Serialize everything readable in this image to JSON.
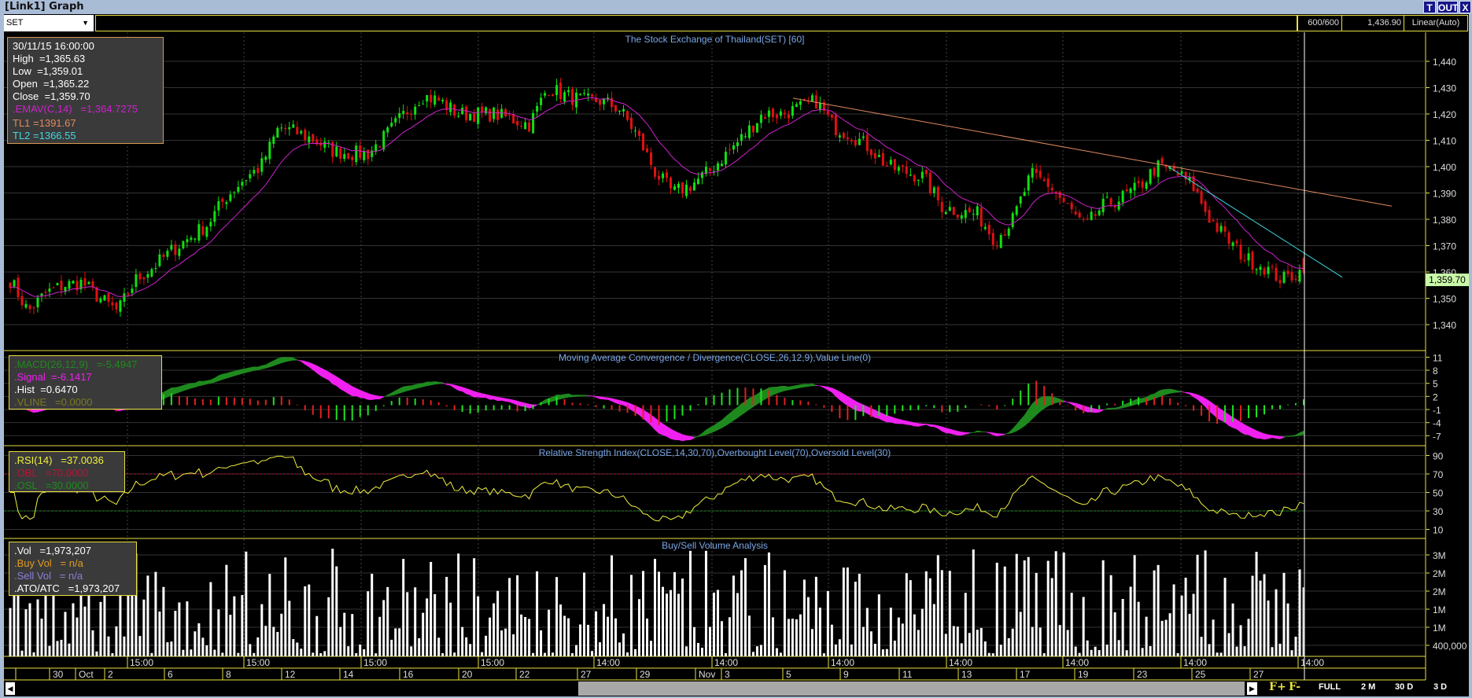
{
  "window": {
    "title": "[Link1] Graph",
    "buttons": [
      "T",
      "OUT",
      "X"
    ]
  },
  "toolbar": {
    "symbol": "SET",
    "bars": "600/600",
    "cursor_price": "1,436.90",
    "scale_mode": "Linear(Auto)"
  },
  "colors": {
    "up": "#10e010",
    "down": "#e01010",
    "ema": "#d020d0",
    "tl1": "#e08a60",
    "tl2": "#40d8e0",
    "axis": "#e8e040",
    "macd": "#1e8a1e",
    "signal": "#f020f0",
    "rsi": "#f0f040",
    "obl": "#b01838",
    "osl": "#1e8a1e",
    "buy": "#e09a20",
    "sell": "#8a80d8",
    "last_price_bg": "#c8f8a8"
  },
  "price_panel": {
    "title": "The Stock Exchange of Thailand(SET) [60]",
    "info": {
      "datetime": "30/11/15 16:00:00",
      "high": "High  =1,365.63",
      "low": "Low  =1,359.01",
      "open": "Open  =1,365.22",
      "close": "Close  =1,359.70",
      "ema": ".EMAV(C,14)   =1,364.7275",
      "tl1": "TL1 =1391.67",
      "tl2": "TL2 =1366.55"
    },
    "y_ticks": [
      "1,440",
      "1,430",
      "1,420",
      "1,410",
      "1,400",
      "1,390",
      "1,380",
      "1,370",
      "1,360",
      "1,350",
      "1,340"
    ],
    "last_price": "1,359.70"
  },
  "macd_panel": {
    "title": "Moving Average Convergence / Divergence(CLOSE,26,12,9),Value Line(0)",
    "info": {
      "macd": ".MACD(26,12,9)   =-5.4947",
      "signal": ".Signal  =-6.1417",
      "hist": ".Hist  =0.6470",
      "vline": ".VLINE   =0.0000"
    },
    "y_ticks": [
      "11",
      "8",
      "5",
      "2",
      "-1",
      "-4",
      "-7"
    ]
  },
  "rsi_panel": {
    "title": "Relative Strength Index(CLOSE,14,30,70),Overbought Level(70),Oversold Level(30)",
    "info": {
      "rsi": ".RSI(14)   =37.0036",
      "obl": ".OBL   =70.0000",
      "osl": ".OSL   =30.0000"
    },
    "y_ticks": [
      "90",
      "70",
      "50",
      "30",
      "10"
    ]
  },
  "volume_panel": {
    "title": "Buy/Sell Volume Analysis",
    "info": {
      "vol": ".Vol   =1,973,207",
      "buy": ".Buy Vol   = n/a",
      "sell": ".Sell Vol   = n/a",
      "ato": ".ATO/ATC   =1,973,207"
    },
    "y_ticks": [
      "3M",
      "2M",
      "2M",
      "1M",
      "1M",
      "400,000"
    ]
  },
  "time_axis": {
    "times": [
      "15:00",
      "15:00",
      "15:00",
      "15:00",
      "14:00",
      "14:00",
      "14:00",
      "14:00",
      "14:00",
      "14:00",
      "14:00"
    ],
    "dates": [
      "30",
      "Oct",
      "2",
      "6",
      "8",
      "12",
      "14",
      "16",
      "20",
      "22",
      "27",
      "29",
      "Nov",
      "3",
      "5",
      "9",
      "11",
      "13",
      "17",
      "19",
      "23",
      "25",
      "27"
    ]
  },
  "controls": {
    "zoom_in": "F+",
    "zoom_out": "F-",
    "ranges": [
      "FULL",
      "2 M",
      "30 D",
      "3 D"
    ]
  },
  "chart_data": {
    "type": "candlestick",
    "interval": "60 min",
    "close_path": [
      1357,
      1345,
      1352,
      1355,
      1356,
      1350,
      1345,
      1357,
      1362,
      1368,
      1373,
      1378,
      1388,
      1395,
      1400,
      1415,
      1413,
      1410,
      1406,
      1405,
      1405,
      1412,
      1420,
      1427,
      1425,
      1420,
      1420,
      1420,
      1418,
      1416,
      1430,
      1427,
      1425,
      1425,
      1422,
      1412,
      1398,
      1390,
      1393,
      1398,
      1405,
      1412,
      1420,
      1420,
      1422,
      1425,
      1415,
      1412,
      1407,
      1400,
      1398,
      1396,
      1385,
      1383,
      1382,
      1372,
      1380,
      1397,
      1393,
      1385,
      1377,
      1385,
      1388,
      1392,
      1400,
      1398,
      1393,
      1380,
      1372,
      1365,
      1362,
      1357,
      1360
    ],
    "last_bar": {
      "open": 1365.22,
      "high": 1365.63,
      "low": 1359.01,
      "close": 1359.7,
      "volume": 1973207
    },
    "ema_period": 14,
    "trendlines": [
      {
        "name": "TL1",
        "from": 1426,
        "to": 1385
      },
      {
        "name": "TL2",
        "from": 1400,
        "to": 1358
      }
    ],
    "price_range": [
      1333,
      1448
    ],
    "macd_range": [
      -8,
      12
    ],
    "rsi_range": [
      5,
      98
    ],
    "rsi_levels": [
      70,
      30
    ],
    "volume_max": 3500000
  }
}
